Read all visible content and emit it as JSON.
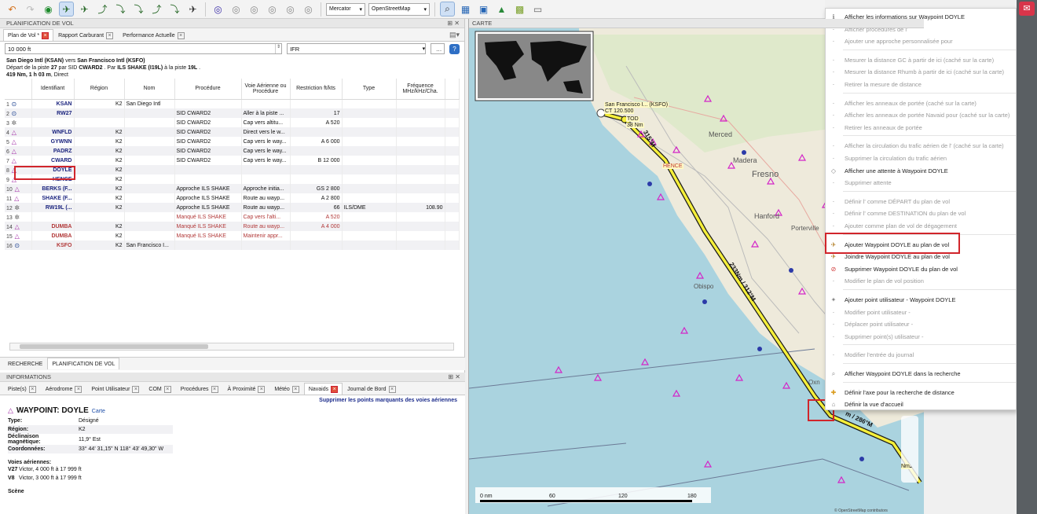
{
  "toolbar": {
    "projection": "Mercator",
    "theme": "OpenStreetMap"
  },
  "left_panel": {
    "title": "PLANIFICATION DE VOL",
    "tabs": [
      {
        "label": "Plan de Vol *"
      },
      {
        "label": "Rapport Carburant"
      },
      {
        "label": "Performance Actuelle"
      }
    ],
    "altitude_value": "10 000 ft",
    "flight_rules": "IFR",
    "summary_line1_a": "San Diego Intl (KSAN)",
    "summary_line1_b": " vers ",
    "summary_line1_c": "San Francisco Intl (KSFO)",
    "summary_line2_a": "Départ de la piste ",
    "summary_line2_b": "27",
    "summary_line2_c": " par SID ",
    "summary_line2_d": "CWARD2",
    "summary_line2_e": " . Par ",
    "summary_line2_f": "ILS SHAKE (I19L)",
    "summary_line2_g": " à la piste ",
    "summary_line2_h": "19L",
    "summary_line2_i": " .",
    "summary_line3_a": "419 Nm, 1 h 03 m",
    "summary_line3_b": ", Direct",
    "columns": [
      "Identifiant",
      "Région",
      "Nom",
      "Procédure",
      "Voie Aérienne ou Procédure",
      "Restriction ft/kts",
      "Type",
      "Fréquence MHz/kHz/Cha."
    ],
    "rows": [
      {
        "n": "1",
        "icon": "vor",
        "id": "KSAN",
        "region": "K2",
        "name": "San Diego Intl",
        "proc": "",
        "airway": "",
        "restr": "",
        "type": "",
        "freq": ""
      },
      {
        "n": "2",
        "icon": "vor",
        "id": "RW27",
        "region": "",
        "name": "",
        "proc": "SID CWARD2",
        "airway": "Aller à la piste ...",
        "restr": "17",
        "type": "",
        "freq": ""
      },
      {
        "n": "3",
        "icon": "ndb",
        "id": "",
        "region": "",
        "name": "",
        "proc": "SID CWARD2",
        "airway": "Cap vers altitu...",
        "restr": "A 520",
        "type": "",
        "freq": ""
      },
      {
        "n": "4",
        "icon": "wpt",
        "id": "WNFLD",
        "region": "K2",
        "name": "",
        "proc": "SID CWARD2",
        "airway": "Direct vers le w...",
        "restr": "",
        "type": "",
        "freq": ""
      },
      {
        "n": "5",
        "icon": "wpt",
        "id": "GYWNN",
        "region": "K2",
        "name": "",
        "proc": "SID CWARD2",
        "airway": "Cap vers le way...",
        "restr": "A 6 000",
        "type": "",
        "freq": ""
      },
      {
        "n": "6",
        "icon": "wpt",
        "id": "PADRZ",
        "region": "K2",
        "name": "",
        "proc": "SID CWARD2",
        "airway": "Cap vers le way...",
        "restr": "",
        "type": "",
        "freq": ""
      },
      {
        "n": "7",
        "icon": "wpt",
        "id": "CWARD",
        "region": "K2",
        "name": "",
        "proc": "SID CWARD2",
        "airway": "Cap vers le way...",
        "restr": "B 12 000",
        "type": "",
        "freq": ""
      },
      {
        "n": "8",
        "icon": "wpt",
        "id": "DOYLE",
        "region": "K2",
        "name": "",
        "proc": "",
        "airway": "",
        "restr": "",
        "type": "",
        "freq": ""
      },
      {
        "n": "9",
        "icon": "wpt",
        "id": "HENCE",
        "region": "K2",
        "name": "",
        "proc": "",
        "airway": "",
        "restr": "",
        "type": "",
        "freq": ""
      },
      {
        "n": "10",
        "icon": "wpt",
        "id": "BERKS (F...",
        "region": "K2",
        "name": "",
        "proc": "Approche ILS SHAKE",
        "airway": "Approche initia...",
        "restr": "GS 2 800",
        "type": "",
        "freq": ""
      },
      {
        "n": "11",
        "icon": "wpt",
        "id": "SHAKE (F...",
        "region": "K2",
        "name": "",
        "proc": "Approche ILS SHAKE",
        "airway": "Route au wayp...",
        "restr": "A 2 800",
        "type": "",
        "freq": ""
      },
      {
        "n": "12",
        "icon": "ndb",
        "id": "RW19L (...",
        "region": "K2",
        "name": "",
        "proc": "Approche ILS SHAKE",
        "airway": "Route au wayp...",
        "restr": "66",
        "type": "ILS/DME",
        "freq": "108.90"
      },
      {
        "n": "13",
        "icon": "ndb",
        "id": "",
        "region": "",
        "name": "",
        "proc": "Manqué ILS SHAKE",
        "airway": "Cap vers l'alti...",
        "restr": "A 520",
        "type": "",
        "freq": ""
      },
      {
        "n": "14",
        "icon": "wpt",
        "id": "DUMBA",
        "region": "K2",
        "name": "",
        "proc": "Manqué ILS SHAKE",
        "airway": "Route au wayp...",
        "restr": "A 4 000",
        "type": "",
        "freq": ""
      },
      {
        "n": "15",
        "icon": "wpt",
        "id": "DUMBA",
        "region": "K2",
        "name": "",
        "proc": "Manqué ILS SHAKE",
        "airway": "Maintenir appr...",
        "restr": "",
        "type": "",
        "freq": ""
      },
      {
        "n": "16",
        "icon": "vor",
        "id": "KSFO",
        "region": "K2",
        "name": "San Francisco I...",
        "proc": "",
        "airway": "",
        "restr": "",
        "type": "",
        "freq": ""
      }
    ],
    "bottom_tabs": [
      {
        "label": "RECHERCHE"
      },
      {
        "label": "PLANIFICATION DE VOL"
      }
    ]
  },
  "info_panel": {
    "title": "INFORMATIONS",
    "tabs": [
      {
        "label": "Piste(s)"
      },
      {
        "label": "Aérodrome"
      },
      {
        "label": "Point Utilisateur"
      },
      {
        "label": "COM"
      },
      {
        "label": "Procédures"
      },
      {
        "label": "À Proximité"
      },
      {
        "label": "Météo"
      },
      {
        "label": "Navaids"
      },
      {
        "label": "Journal de Bord"
      }
    ],
    "remove_link": "Supprimer les points marquants des voies aériennes",
    "heading": "WAYPOINT: DOYLE",
    "map_link": "Carte",
    "fields": [
      {
        "k": "Type:",
        "v": "Désigné"
      },
      {
        "k": "Région:",
        "v": "K2"
      },
      {
        "k": "Déclinaison magnétique:",
        "v": "11,9° Est"
      },
      {
        "k": "Coordonnées:",
        "v": "33° 44' 31,15\" N 118° 43' 49,30\" W"
      }
    ],
    "airways_title": "Voies aériennes:",
    "airways": [
      {
        "k": "V27",
        "v": "Victor, 4 000 ft à 17 999 ft"
      },
      {
        "k": "V8",
        "v": "Victor, 3 000 ft à 17 999 ft"
      }
    ],
    "scene_title": "Scène"
  },
  "map": {
    "title": "CARTE",
    "labels": {
      "sf": "San Francisco I... (KSFO)",
      "ct": "CT 120.500",
      "tod": "TOD",
      "dist38": "38 Nm",
      "hence": "HENCE",
      "merced": "Merced",
      "madera": "Madera",
      "fresno": "Fresno",
      "hanford": "Hanford",
      "porterville": "Porterville",
      "obispo": "Obispo",
      "oxn": "Oxn",
      "leg1": "315°M",
      "leg2": "233Nm / 312°M",
      "leg3": "m / 286°M",
      "nm": "Nm"
    },
    "scale": {
      "ticks": [
        "0 nm",
        "60",
        "120",
        "180"
      ]
    },
    "attribution": "© OpenStreetMap contributors"
  },
  "context_menu": {
    "items": [
      {
        "label": "Afficher les informations sur Waypoint DOYLE",
        "enabled": true,
        "icon": "info-icon"
      },
      {
        "label": "Afficher procédures  de l'",
        "enabled": false,
        "icon": "procedure-icon"
      },
      {
        "label": "Ajouter une approche personnalisée pour",
        "enabled": false,
        "icon": "approach-icon"
      },
      {
        "sep": true
      },
      {
        "label": "Mesurer la distance GC à partir de ici (caché sur la carte)",
        "enabled": false,
        "icon": "measure-gc-icon"
      },
      {
        "label": "Mesurer la distance Rhumb à partir de ici (caché sur la carte)",
        "enabled": false,
        "icon": "measure-rhumb-icon"
      },
      {
        "label": "Retirer la mesure de distance",
        "enabled": false,
        "icon": "remove-measure-icon"
      },
      {
        "sep": true
      },
      {
        "label": "Afficher les anneaux de portée (caché sur la carte)",
        "enabled": false,
        "icon": "range-rings-icon"
      },
      {
        "label": "Afficher les anneaux de portée Navaid pour  (caché sur la carte)",
        "enabled": false,
        "icon": "navaid-rings-icon"
      },
      {
        "label": "Retirer les anneaux de portée",
        "enabled": false,
        "icon": "remove-rings-icon"
      },
      {
        "sep": true
      },
      {
        "label": "Afficher la circulation du trafic aérien de l' (caché sur la carte)",
        "enabled": false,
        "icon": "traffic-pattern-icon"
      },
      {
        "label": "Supprimer la circulation du trafic aérien",
        "enabled": false,
        "icon": "remove-traffic-icon"
      },
      {
        "label": "Afficher une attente à Waypoint DOYLE",
        "enabled": true,
        "icon": "hold-icon"
      },
      {
        "label": "Supprimer attente",
        "enabled": false,
        "icon": "remove-hold-icon"
      },
      {
        "sep": true
      },
      {
        "label": "Définir l' comme DÉPART du plan de vol",
        "enabled": false,
        "icon": "departure-icon"
      },
      {
        "label": "Définir l' comme DESTINATION du plan de vol",
        "enabled": false,
        "icon": "destination-icon"
      },
      {
        "label": "Ajouter  comme plan de vol de dégagement",
        "enabled": false,
        "icon": "alternate-icon"
      },
      {
        "sep": true
      },
      {
        "label": "Ajouter Waypoint DOYLE au plan de vol",
        "enabled": true,
        "icon": "add-waypoint-icon"
      },
      {
        "label": "Joindre Waypoint DOYLE au plan de vol",
        "enabled": true,
        "icon": "append-waypoint-icon"
      },
      {
        "label": "Supprimer Waypoint DOYLE du plan de vol",
        "enabled": true,
        "icon": "delete-waypoint-icon"
      },
      {
        "label": "Modifier le plan de vol position",
        "enabled": false,
        "icon": "edit-position-icon"
      },
      {
        "sep": true
      },
      {
        "label": "Ajouter point utilisateur - Waypoint DOYLE",
        "enabled": true,
        "icon": "add-userpoint-icon"
      },
      {
        "label": "Modifier point utilisateur -",
        "enabled": false,
        "icon": "edit-userpoint-icon"
      },
      {
        "label": "Déplacer point utilisateur -",
        "enabled": false,
        "icon": "move-userpoint-icon"
      },
      {
        "label": "Supprimer point(s) utilisateur -",
        "enabled": false,
        "icon": "delete-userpoint-icon"
      },
      {
        "sep": true
      },
      {
        "label": "Modifier l'entrée du journal",
        "enabled": false,
        "icon": "logbook-icon"
      },
      {
        "sep": true
      },
      {
        "label": "Afficher Waypoint DOYLE dans la recherche",
        "enabled": true,
        "icon": "search-icon"
      },
      {
        "sep": true
      },
      {
        "label": "Définir l'axe pour la recherche de distance",
        "enabled": true,
        "icon": "center-distance-icon"
      },
      {
        "label": "Définir la vue d'accueil",
        "enabled": true,
        "icon": "home-view-icon"
      }
    ]
  }
}
